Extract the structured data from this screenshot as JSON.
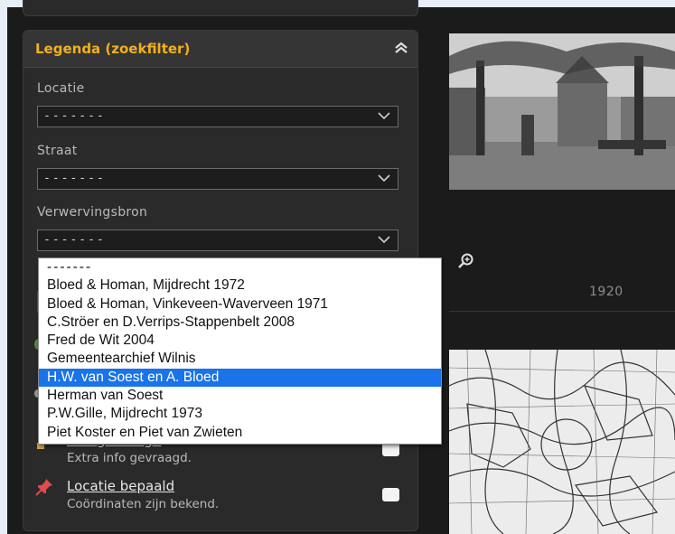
{
  "legend": {
    "title": "Legenda (zoekfilter)",
    "fields": [
      {
        "label": "Locatie",
        "value": "-------"
      },
      {
        "label": "Straat",
        "value": "-------"
      },
      {
        "label": "Verwervingsbron",
        "value": "-------"
      }
    ],
    "items": [
      {
        "title": "Info gevraagd",
        "desc": "Extra info gevraagd."
      },
      {
        "title": "Locatie bepaald",
        "desc": "Coördinaten zijn bekend."
      }
    ]
  },
  "dropdown": {
    "options": [
      "-------",
      "Bloed & Homan, Mijdrecht 1972",
      "Bloed & Homan, Vinkeveen-Waverveen 1971",
      "C.Ströer en D.Verrips-Stappenbelt 2008",
      "Fred de Wit 2004",
      "Gemeentearchief Wilnis",
      "H.W. van Soest en A. Bloed",
      "Herman van Soest",
      "P.W.Gille, Mijdrecht 1973",
      "Piet Koster en Piet van Zwieten"
    ],
    "selected_index": 6
  },
  "results": {
    "year": "1920"
  },
  "icons": {
    "collapse": "double-chevron-up-icon",
    "chevron": "chevron-down-icon",
    "zoom": "zoom-in-icon",
    "pin": "pushpin-icon",
    "lock": "lock-icon"
  },
  "colors": {
    "accent": "#f2b01e",
    "selected": "#1a73e8",
    "pin": "#e04b4b"
  }
}
